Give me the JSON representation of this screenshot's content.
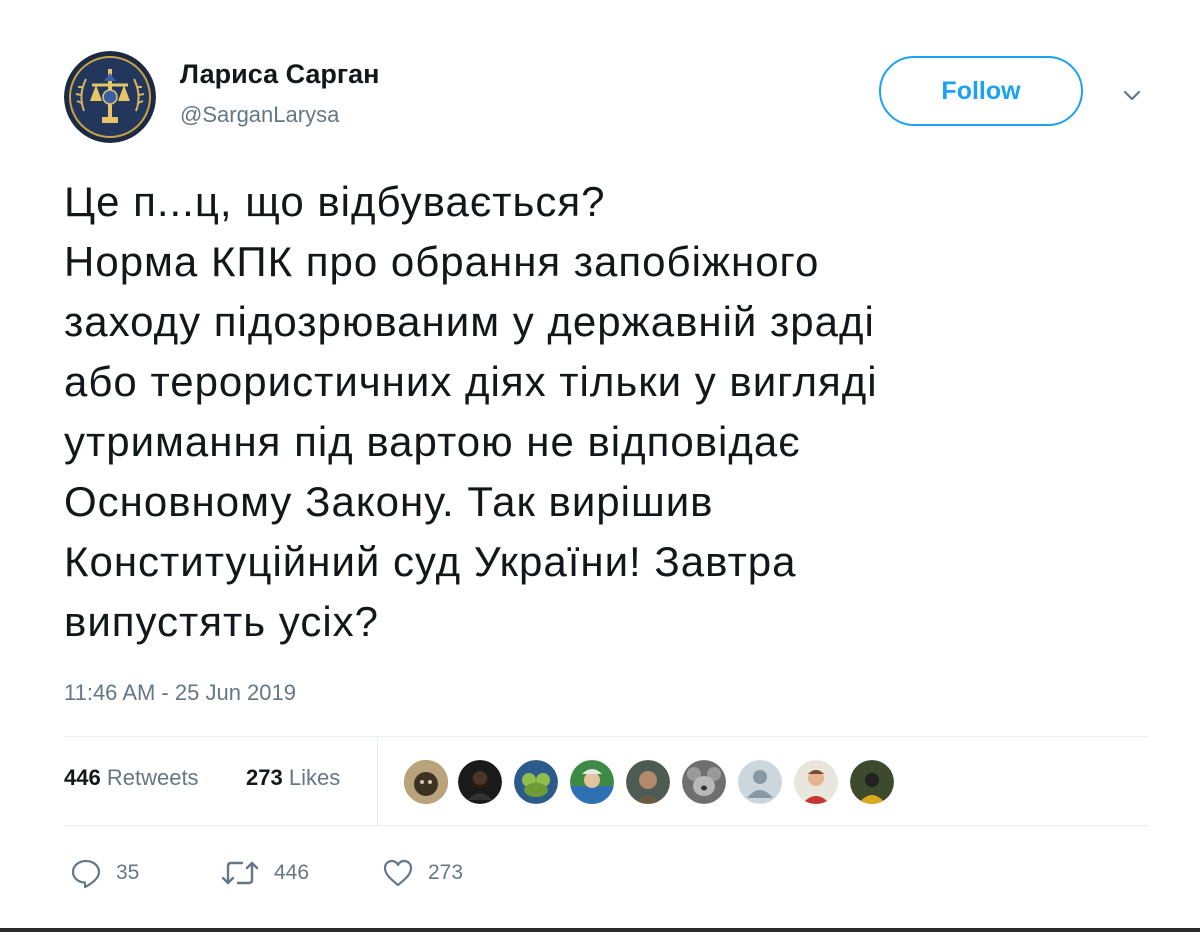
{
  "author": {
    "display_name": "Лариса Сарган",
    "handle": "@SarganLarysa"
  },
  "follow_label": "Follow",
  "tweet": {
    "lines": [
      "Це п...ц, що відбувається?",
      "Норма КПК про обрання запобіжного",
      "заходу підозрюваним у державній зраді",
      "або терористичних діях тільки у вигляді",
      "утримання під вартою не відповідає",
      "Основному Закону. Так вирішив",
      "Конституційний суд України! Завтра",
      "випустять усіх?"
    ],
    "timestamp": "11:46 AM - 25 Jun 2019"
  },
  "stats": {
    "retweets_count": "446",
    "retweets_label": "Retweets",
    "likes_count": "273",
    "likes_label": "Likes"
  },
  "actions": {
    "reply_count": "35",
    "retweet_count": "446",
    "like_count": "273"
  },
  "colors": {
    "accent": "#1da1f2",
    "secondary_text": "#657786",
    "divider": "#e6ecf0"
  }
}
